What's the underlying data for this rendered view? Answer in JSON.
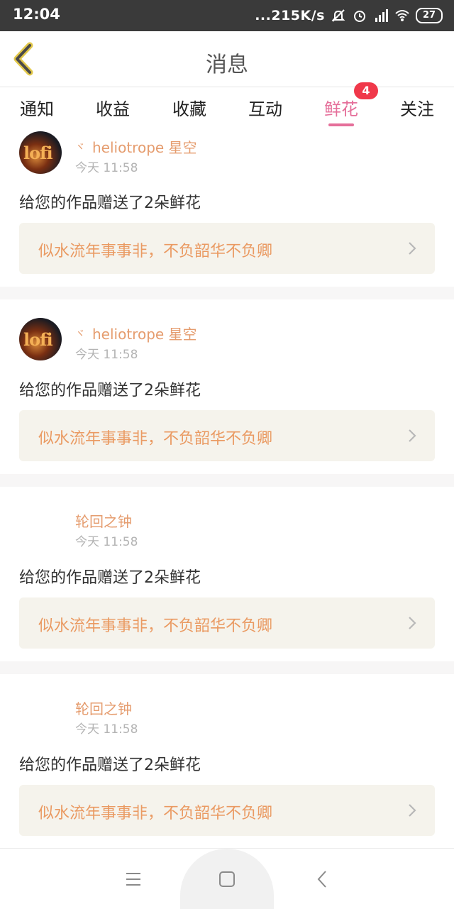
{
  "status_bar": {
    "time": "12:04",
    "network_speed": "...215K/s",
    "battery": "27",
    "icons": [
      "mute-icon",
      "alarm-icon",
      "signal-icon",
      "wifi-icon",
      "battery-icon"
    ]
  },
  "header": {
    "title": "消息",
    "back_icon": "chevron-left-icon"
  },
  "tabs": [
    {
      "label": "通知"
    },
    {
      "label": "收益"
    },
    {
      "label": "收藏"
    },
    {
      "label": "互动"
    },
    {
      "label": "鲜花",
      "active": true,
      "badge": "4"
    },
    {
      "label": "关注"
    }
  ],
  "messages": [
    {
      "mark": "ヾ",
      "sender": "heliotrope 星空",
      "time": "今天 11:58",
      "text": "给您的作品赠送了2朵鲜花",
      "quote": "似水流年事事非，不负韶华不负卿",
      "has_avatar": true,
      "avatar_text": "lofi"
    },
    {
      "mark": "ヾ",
      "sender": "heliotrope 星空",
      "time": "今天 11:58",
      "text": "给您的作品赠送了2朵鲜花",
      "quote": "似水流年事事非，不负韶华不负卿",
      "has_avatar": true,
      "avatar_text": "lofi"
    },
    {
      "mark": "",
      "sender": "轮回之钟",
      "time": "今天 11:58",
      "text": "给您的作品赠送了2朵鲜花",
      "quote": "似水流年事事非，不负韶华不负卿",
      "has_avatar": false
    },
    {
      "mark": "",
      "sender": "轮回之钟",
      "time": "今天 11:58",
      "text": "给您的作品赠送了2朵鲜花",
      "quote": "似水流年事事非，不负韶华不负卿",
      "has_avatar": false
    }
  ],
  "colors": {
    "accent": "#e56f9a",
    "sender": "#e59c6e",
    "quote_text": "#ea9a62",
    "quote_bg": "#f5f3ec",
    "badge": "#f0384a"
  },
  "nav_bar": {
    "icons": [
      "menu-icon",
      "home-square-icon",
      "back-chevron-icon"
    ]
  }
}
